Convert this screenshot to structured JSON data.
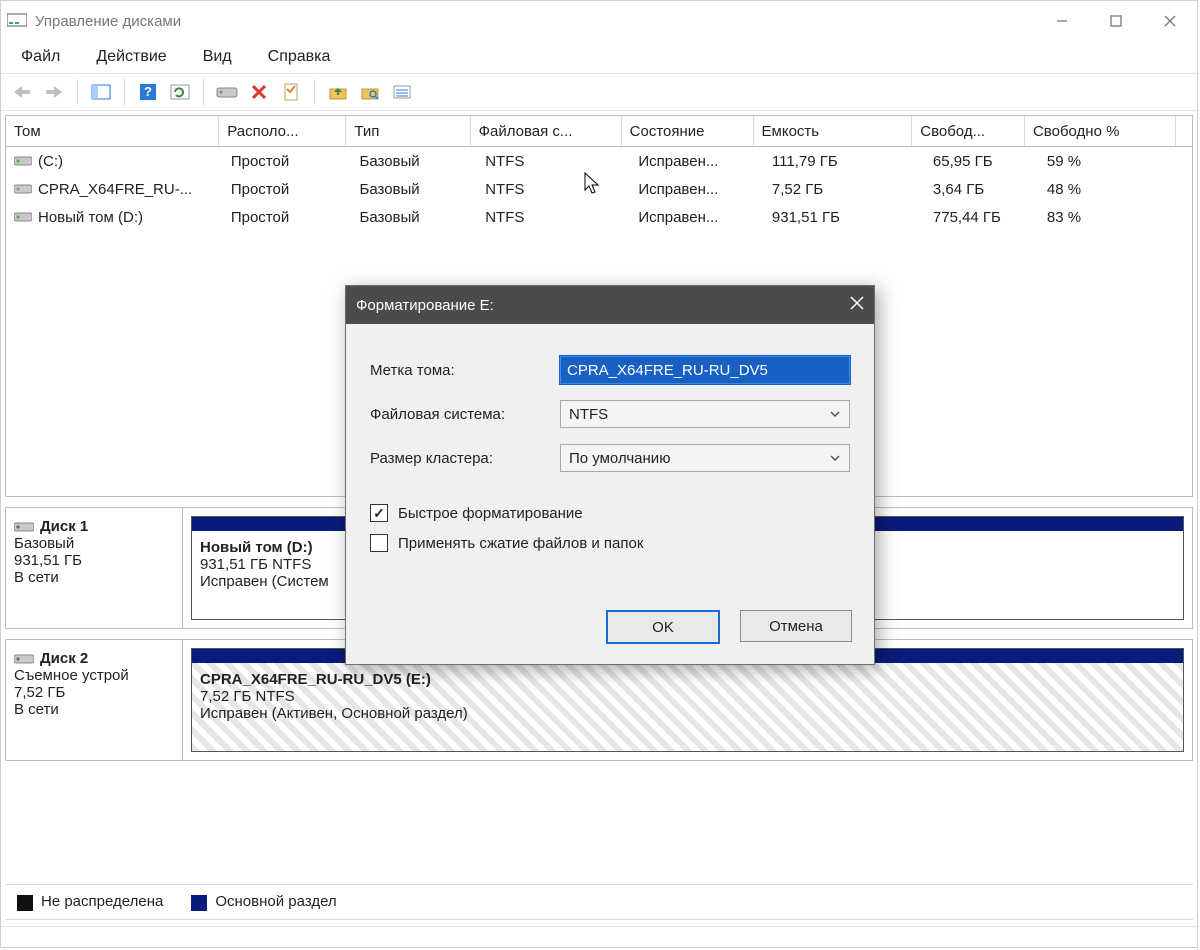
{
  "window": {
    "title": "Управление дисками"
  },
  "menu": {
    "file": "Файл",
    "action": "Действие",
    "view": "Вид",
    "help": "Справка"
  },
  "volumes": {
    "columns": [
      "Том",
      "Располо...",
      "Тип",
      "Файловая с...",
      "Состояние",
      "Емкость",
      "Свобод...",
      "Свободно %"
    ],
    "rows": [
      {
        "name": "(C:)",
        "layout": "Простой",
        "type": "Базовый",
        "fs": "NTFS",
        "state": "Исправен...",
        "cap": "111,79 ГБ",
        "free": "65,95 ГБ",
        "freep": "59 %",
        "icon": "green"
      },
      {
        "name": "CPRA_X64FRE_RU-...",
        "layout": "Простой",
        "type": "Базовый",
        "fs": "NTFS",
        "state": "Исправен...",
        "cap": "7,52 ГБ",
        "free": "3,64 ГБ",
        "freep": "48 %",
        "icon": "grey"
      },
      {
        "name": "Новый том (D:)",
        "layout": "Простой",
        "type": "Базовый",
        "fs": "NTFS",
        "state": "Исправен...",
        "cap": "931,51 ГБ",
        "free": "775,44 ГБ",
        "freep": "83 %",
        "icon": "green"
      }
    ]
  },
  "disks": [
    {
      "label": {
        "name": "Диск 1",
        "type": "Базовый",
        "size": "931,51 ГБ",
        "status": "В сети"
      },
      "partition": {
        "title": "Новый том  (D:)",
        "line2": "931,51 ГБ NTFS",
        "line3": "Исправен (Систем",
        "hatched": false
      }
    },
    {
      "label": {
        "name": "Диск 2",
        "type": "Съемное устрой",
        "size": "7,52 ГБ",
        "status": "В сети"
      },
      "partition": {
        "title": "CPRA_X64FRE_RU-RU_DV5  (E:)",
        "line2": "7,52 ГБ NTFS",
        "line3": "Исправен (Активен, Основной раздел)",
        "hatched": true
      }
    }
  ],
  "legend": {
    "unallocated": "Не распределена",
    "primary": "Основной раздел"
  },
  "dialog": {
    "title": "Форматирование E:",
    "labels": {
      "volume": "Метка тома:",
      "fs": "Файловая система:",
      "cluster": "Размер кластера:"
    },
    "values": {
      "volume": "CPRA_X64FRE_RU-RU_DV5",
      "fs": "NTFS",
      "cluster": "По умолчанию"
    },
    "checks": {
      "quick": "Быстрое форматирование",
      "compress": "Применять сжатие файлов и папок"
    },
    "buttons": {
      "ok": "OK",
      "cancel": "Отмена"
    }
  }
}
